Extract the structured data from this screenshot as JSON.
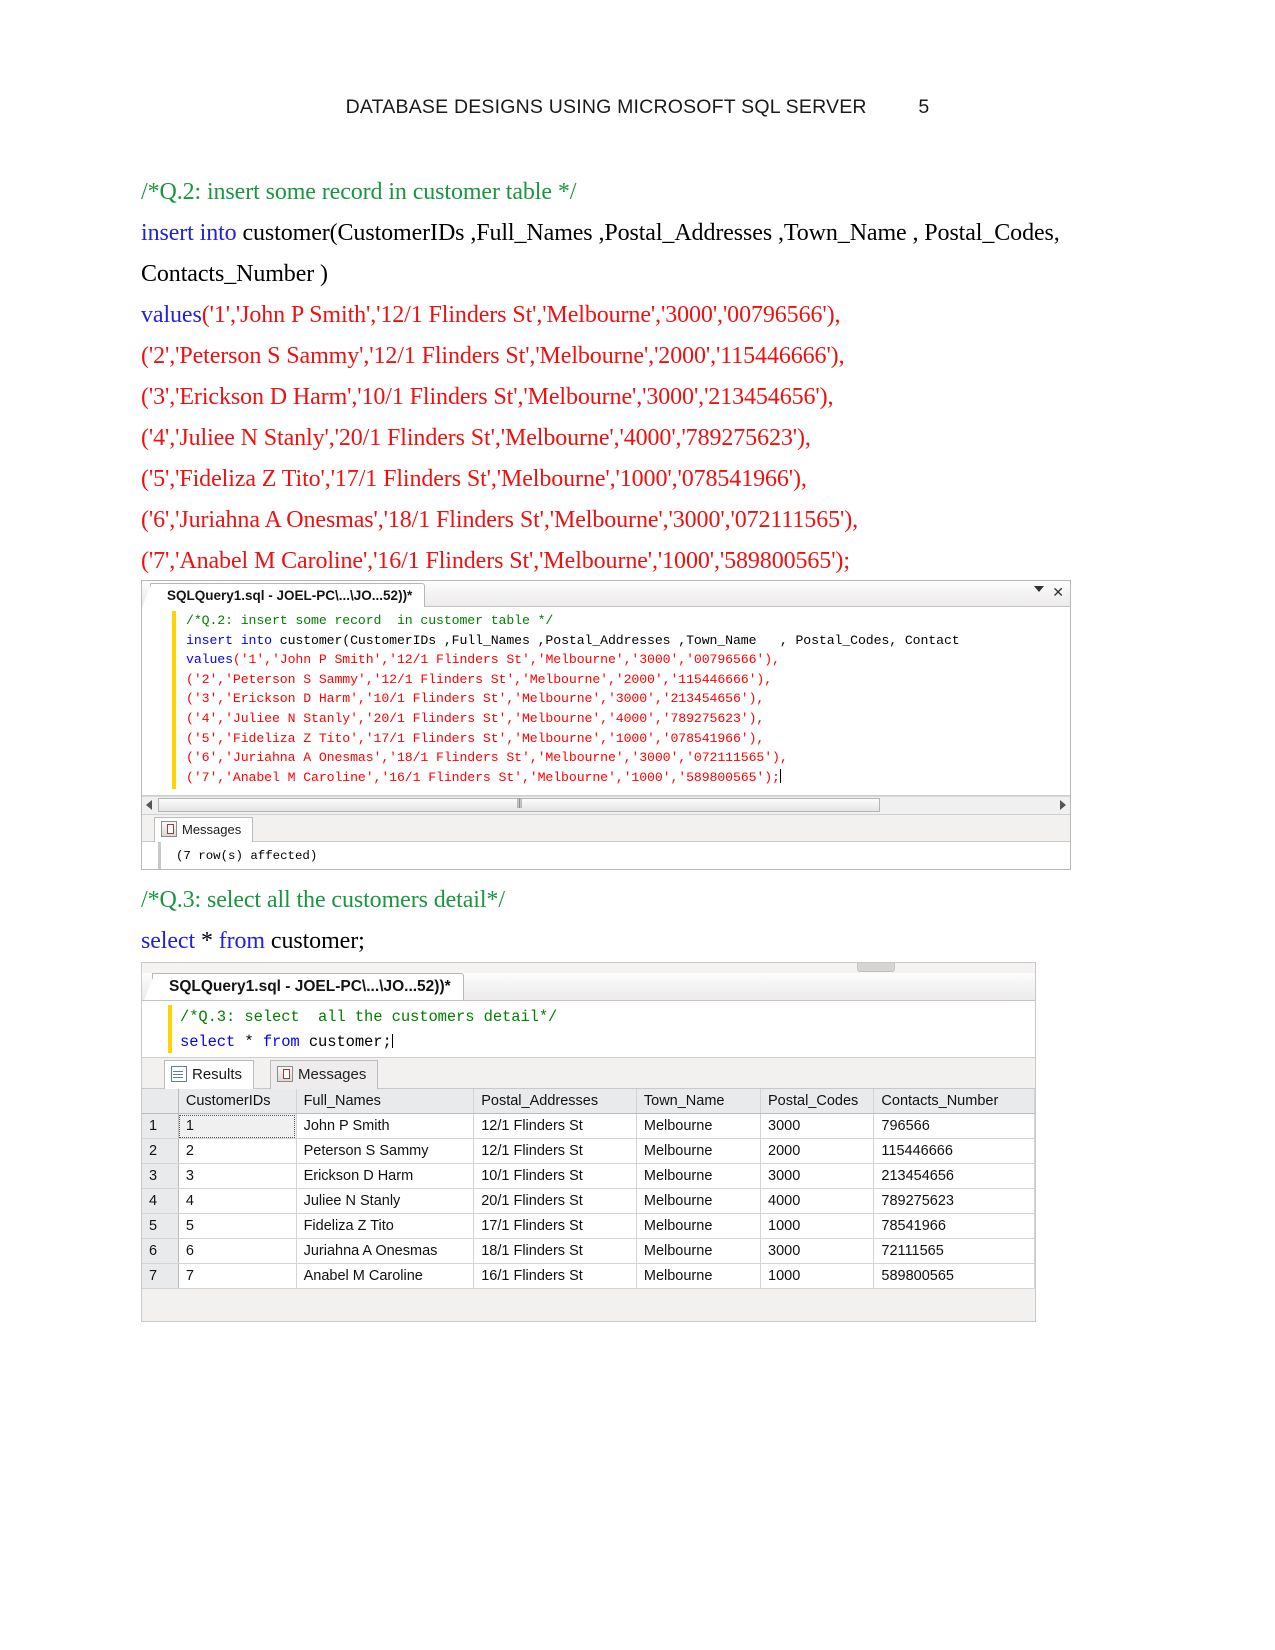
{
  "header": {
    "title": "DATABASE DESIGNS USING MICROSOFT SQL SERVER",
    "page_number": "5"
  },
  "document": {
    "q2_comment": "/*Q.2: insert some record  in customer table */",
    "insert_kw": "insert into",
    "insert_rest": " customer(CustomerIDs ,Full_Names ,Postal_Addresses ,Town_Name  , Postal_Codes,",
    "insert_cont": "Contacts_Number )",
    "values_kw": "values",
    "values_row1": "('1','John P Smith','12/1 Flinders St','Melbourne','3000','00796566'),",
    "values_row2": "('2','Peterson S Sammy','12/1 Flinders St','Melbourne','2000','115446666'),",
    "values_row3": "('3','Erickson D Harm','10/1 Flinders St','Melbourne','3000','213454656'),",
    "values_row4": "('4','Juliee N Stanly','20/1 Flinders St','Melbourne','4000','789275623'),",
    "values_row5": "('5','Fideliza Z Tito','17/1 Flinders St','Melbourne','1000','078541966'),",
    "values_row6": "('6','Juriahna A Onesmas','18/1 Flinders St','Melbourne','3000','072111565'),",
    "values_row7": "('7','Anabel M Caroline','16/1 Flinders St','Melbourne','1000','589800565');",
    "q3_comment": "/*Q.3: select  all the customers detail*/",
    "select_kw": "select",
    "select_star": " * ",
    "from_kw": "from",
    "select_rest": " customer;"
  },
  "ssms1": {
    "tab_title": "SQLQuery1.sql - JOEL-PC\\...\\JO...52))*",
    "close_glyph": "✕",
    "code": {
      "line1_comment": "/*Q.2: insert some record  in customer table */",
      "line2_kw": "insert into",
      "line2_rest": " customer(CustomerIDs ,Full_Names ,Postal_Addresses ,Town_Name   , Postal_Codes, Contact",
      "line3_kw": "values",
      "line3_rest": "('1','John P Smith','12/1 Flinders St','Melbourne','3000','00796566'),",
      "line4": "('2','Peterson S Sammy','12/1 Flinders St','Melbourne','2000','115446666'),",
      "line5": "('3','Erickson D Harm','10/1 Flinders St','Melbourne','3000','213454656'),",
      "line6": "('4','Juliee N Stanly','20/1 Flinders St','Melbourne','4000','789275623'),",
      "line7": "('5','Fideliza Z Tito','17/1 Flinders St','Melbourne','1000','078541966'),",
      "line8": "('6','Juriahna A Onesmas','18/1 Flinders St','Melbourne','3000','072111565'),",
      "line9": "('7','Anabel M Caroline','16/1 Flinders St','Melbourne','1000','589800565');"
    },
    "messages_tab": "Messages",
    "message_text": "(7 row(s) affected)"
  },
  "ssms2": {
    "tab_title": "SQLQuery1.sql - JOEL-PC\\...\\JO...52))*",
    "code": {
      "line1_comment": "/*Q.3: select  all the customers detail*/",
      "line2_kw": "select",
      "line2_star": " * ",
      "line2_from": "from",
      "line2_rest": " customer;"
    },
    "results_tab": "Results",
    "messages_tab": "Messages",
    "grid": {
      "columns": [
        "CustomerIDs",
        "Full_Names",
        "Postal_Addresses",
        "Town_Name",
        "Postal_Codes",
        "Contacts_Number"
      ],
      "rows": [
        {
          "n": "1",
          "CustomerIDs": "1",
          "Full_Names": "John P Smith",
          "Postal_Addresses": "12/1 Flinders St",
          "Town_Name": "Melbourne",
          "Postal_Codes": "3000",
          "Contacts_Number": "796566"
        },
        {
          "n": "2",
          "CustomerIDs": "2",
          "Full_Names": "Peterson S Sammy",
          "Postal_Addresses": "12/1 Flinders St",
          "Town_Name": "Melbourne",
          "Postal_Codes": "2000",
          "Contacts_Number": "115446666"
        },
        {
          "n": "3",
          "CustomerIDs": "3",
          "Full_Names": "Erickson D Harm",
          "Postal_Addresses": "10/1 Flinders St",
          "Town_Name": "Melbourne",
          "Postal_Codes": "3000",
          "Contacts_Number": "213454656"
        },
        {
          "n": "4",
          "CustomerIDs": "4",
          "Full_Names": "Juliee N Stanly",
          "Postal_Addresses": "20/1 Flinders St",
          "Town_Name": "Melbourne",
          "Postal_Codes": "4000",
          "Contacts_Number": "789275623"
        },
        {
          "n": "5",
          "CustomerIDs": "5",
          "Full_Names": "Fideliza Z Tito",
          "Postal_Addresses": "17/1 Flinders St",
          "Town_Name": "Melbourne",
          "Postal_Codes": "1000",
          "Contacts_Number": "78541966"
        },
        {
          "n": "6",
          "CustomerIDs": "6",
          "Full_Names": "Juriahna A Onesmas",
          "Postal_Addresses": "18/1 Flinders St",
          "Town_Name": "Melbourne",
          "Postal_Codes": "3000",
          "Contacts_Number": "72111565"
        },
        {
          "n": "7",
          "CustomerIDs": "7",
          "Full_Names": "Anabel M Caroline",
          "Postal_Addresses": "16/1 Flinders St",
          "Town_Name": "Melbourne",
          "Postal_Codes": "1000",
          "Contacts_Number": "589800565"
        }
      ]
    }
  }
}
